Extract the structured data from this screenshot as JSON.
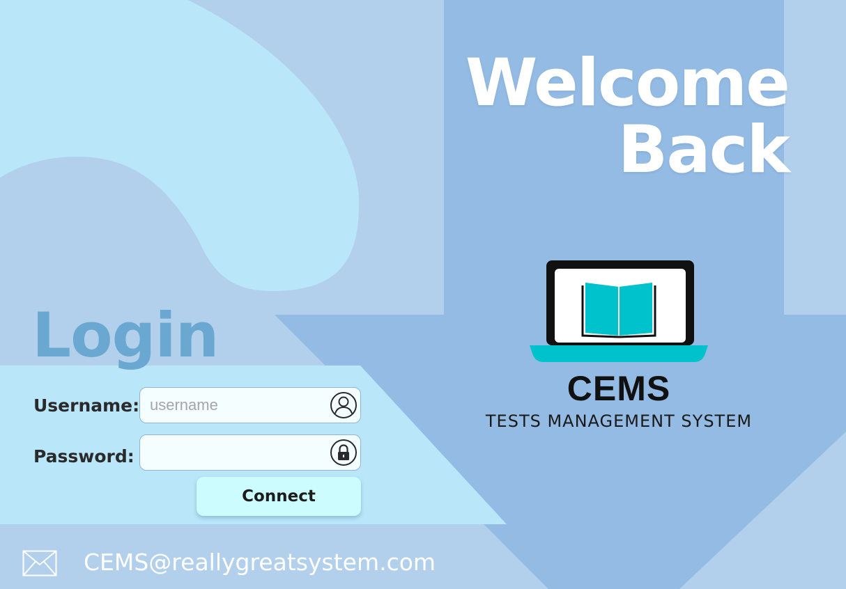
{
  "welcome": {
    "line1": "Welcome",
    "line2": "Back"
  },
  "brand": {
    "name": "CEMS",
    "tagline": "TESTS MANAGEMENT SYSTEM"
  },
  "login": {
    "title": "Login",
    "username_label": "Username:",
    "username_placeholder": "username",
    "username_value": "",
    "password_label": "Password:",
    "password_value": "",
    "connect_label": "Connect"
  },
  "contact": {
    "email": "CEMS@reallygreatsystem.com"
  },
  "icons": {
    "username": "user-icon",
    "password": "lock-icon",
    "logo": "laptop-book-icon",
    "email": "envelope-icon"
  },
  "colors": {
    "background": "#b2d0ec",
    "light_shape": "#bae6fa",
    "arrow": "#93bbe3",
    "login_title": "#6aa8d2",
    "button": "#ccfcfe",
    "logo_accent": "#00c2cc"
  }
}
